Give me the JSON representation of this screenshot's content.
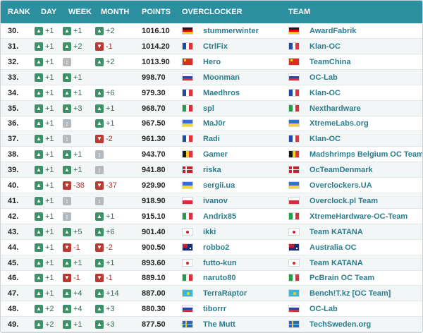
{
  "header": {
    "rank": "RANK",
    "day": "DAY",
    "week": "WEEK",
    "month": "MONTH",
    "points": "POINTS",
    "overclocker": "OVERCLOCKER",
    "team": "TEAM"
  },
  "colors": {
    "header_bg": "#2b8fa0",
    "up": "#3d9068",
    "down": "#b83a33",
    "unchanged": "#b3b9bc",
    "link": "#2b7c8c"
  },
  "rows": [
    {
      "rank": "30.",
      "day": {
        "dir": "up",
        "value": "+1"
      },
      "week": {
        "dir": "up",
        "value": "+1"
      },
      "month": {
        "dir": "up",
        "value": "+2"
      },
      "points": "1016.10",
      "flag": "germany",
      "overclocker": "stummerwinter",
      "team_flag": "germany",
      "team": "AwardFabrik"
    },
    {
      "rank": "31.",
      "day": {
        "dir": "up",
        "value": "+1"
      },
      "week": {
        "dir": "up",
        "value": "+2"
      },
      "month": {
        "dir": "down",
        "value": "-1"
      },
      "points": "1014.20",
      "flag": "france",
      "overclocker": "CtrlFix",
      "team_flag": "france",
      "team": "Klan-OC"
    },
    {
      "rank": "32.",
      "day": {
        "dir": "up",
        "value": "+1"
      },
      "week": {
        "dir": "same",
        "value": ""
      },
      "month": {
        "dir": "up",
        "value": "+2"
      },
      "points": "1013.90",
      "flag": "china",
      "overclocker": "Hero",
      "team_flag": "china",
      "team": "TeamChina"
    },
    {
      "rank": "33.",
      "day": {
        "dir": "up",
        "value": "+1"
      },
      "week": {
        "dir": "up",
        "value": "+1"
      },
      "month": {
        "dir": "none",
        "value": ""
      },
      "points": "998.70",
      "flag": "slovenia",
      "overclocker": "Moonman",
      "team_flag": "slovenia",
      "team": "OC-Lab"
    },
    {
      "rank": "34.",
      "day": {
        "dir": "up",
        "value": "+1"
      },
      "week": {
        "dir": "up",
        "value": "+1"
      },
      "month": {
        "dir": "up",
        "value": "+6"
      },
      "points": "979.30",
      "flag": "france",
      "overclocker": "Maedhros",
      "team_flag": "france",
      "team": "Klan-OC"
    },
    {
      "rank": "35.",
      "day": {
        "dir": "up",
        "value": "+1"
      },
      "week": {
        "dir": "up",
        "value": "+3"
      },
      "month": {
        "dir": "up",
        "value": "+1"
      },
      "points": "968.70",
      "flag": "italy",
      "overclocker": "spl",
      "team_flag": "italy",
      "team": "Nexthardware"
    },
    {
      "rank": "36.",
      "day": {
        "dir": "up",
        "value": "+1"
      },
      "week": {
        "dir": "same",
        "value": ""
      },
      "month": {
        "dir": "up",
        "value": "+1"
      },
      "points": "967.50",
      "flag": "ukraine",
      "overclocker": "MaJ0r",
      "team_flag": "ukraine",
      "team": "XtremeLabs.org"
    },
    {
      "rank": "37.",
      "day": {
        "dir": "up",
        "value": "+1"
      },
      "week": {
        "dir": "same",
        "value": ""
      },
      "month": {
        "dir": "down",
        "value": "-2"
      },
      "points": "961.30",
      "flag": "france",
      "overclocker": "Radi",
      "team_flag": "france",
      "team": "Klan-OC"
    },
    {
      "rank": "38.",
      "day": {
        "dir": "up",
        "value": "+1"
      },
      "week": {
        "dir": "up",
        "value": "+1"
      },
      "month": {
        "dir": "same",
        "value": ""
      },
      "points": "943.70",
      "flag": "belgium",
      "overclocker": "Gamer",
      "team_flag": "belgium",
      "team": "Madshrimps Belgium OC Team"
    },
    {
      "rank": "39.",
      "day": {
        "dir": "up",
        "value": "+1"
      },
      "week": {
        "dir": "up",
        "value": "+1"
      },
      "month": {
        "dir": "same",
        "value": ""
      },
      "points": "941.80",
      "flag": "denmark",
      "overclocker": "riska",
      "team_flag": "denmark",
      "team": "OcTeamDenmark"
    },
    {
      "rank": "40.",
      "day": {
        "dir": "up",
        "value": "+1"
      },
      "week": {
        "dir": "down",
        "value": "-38"
      },
      "month": {
        "dir": "down",
        "value": "-37"
      },
      "points": "929.90",
      "flag": "ukraine",
      "overclocker": "sergii.ua",
      "team_flag": "ukraine",
      "team": "Overclockers.UA"
    },
    {
      "rank": "41.",
      "day": {
        "dir": "up",
        "value": "+1"
      },
      "week": {
        "dir": "same",
        "value": ""
      },
      "month": {
        "dir": "same",
        "value": ""
      },
      "points": "918.90",
      "flag": "poland",
      "overclocker": "ivanov",
      "team_flag": "poland",
      "team": "Overclock.pl Team"
    },
    {
      "rank": "42.",
      "day": {
        "dir": "up",
        "value": "+1"
      },
      "week": {
        "dir": "same",
        "value": ""
      },
      "month": {
        "dir": "up",
        "value": "+1"
      },
      "points": "915.10",
      "flag": "italy",
      "overclocker": "Andrix85",
      "team_flag": "italy",
      "team": "XtremeHardware-OC-Team"
    },
    {
      "rank": "43.",
      "day": {
        "dir": "up",
        "value": "+1"
      },
      "week": {
        "dir": "up",
        "value": "+5"
      },
      "month": {
        "dir": "up",
        "value": "+6"
      },
      "points": "901.40",
      "flag": "japan",
      "overclocker": "ikki",
      "team_flag": "japan",
      "team": "Team KATANA"
    },
    {
      "rank": "44.",
      "day": {
        "dir": "up",
        "value": "+1"
      },
      "week": {
        "dir": "down",
        "value": "-1"
      },
      "month": {
        "dir": "down",
        "value": "-2"
      },
      "points": "900.50",
      "flag": "australia",
      "overclocker": "robbo2",
      "team_flag": "australia",
      "team": "Australia OC"
    },
    {
      "rank": "45.",
      "day": {
        "dir": "up",
        "value": "+1"
      },
      "week": {
        "dir": "up",
        "value": "+1"
      },
      "month": {
        "dir": "up",
        "value": "+1"
      },
      "points": "893.60",
      "flag": "japan",
      "overclocker": "futto-kun",
      "team_flag": "japan",
      "team": "Team KATANA"
    },
    {
      "rank": "46.",
      "day": {
        "dir": "up",
        "value": "+1"
      },
      "week": {
        "dir": "down",
        "value": "-1"
      },
      "month": {
        "dir": "down",
        "value": "-1"
      },
      "points": "889.10",
      "flag": "italy",
      "overclocker": "naruto80",
      "team_flag": "italy",
      "team": "PcBrain OC Team"
    },
    {
      "rank": "47.",
      "day": {
        "dir": "up",
        "value": "+1"
      },
      "week": {
        "dir": "up",
        "value": "+4"
      },
      "month": {
        "dir": "up",
        "value": "+14"
      },
      "points": "887.00",
      "flag": "kazakhstan",
      "overclocker": "TerraRaptor",
      "team_flag": "kazakhstan",
      "team": "Bench!T.kz [OC Team]"
    },
    {
      "rank": "48.",
      "day": {
        "dir": "up",
        "value": "+2"
      },
      "week": {
        "dir": "up",
        "value": "+4"
      },
      "month": {
        "dir": "up",
        "value": "+3"
      },
      "points": "880.30",
      "flag": "slovenia",
      "overclocker": "tiborrr",
      "team_flag": "slovenia",
      "team": "OC-Lab"
    },
    {
      "rank": "49.",
      "day": {
        "dir": "up",
        "value": "+2"
      },
      "week": {
        "dir": "up",
        "value": "+1"
      },
      "month": {
        "dir": "up",
        "value": "+3"
      },
      "points": "877.50",
      "flag": "sweden",
      "overclocker": "The Mutt",
      "team_flag": "sweden",
      "team": "TechSweden.org"
    }
  ]
}
